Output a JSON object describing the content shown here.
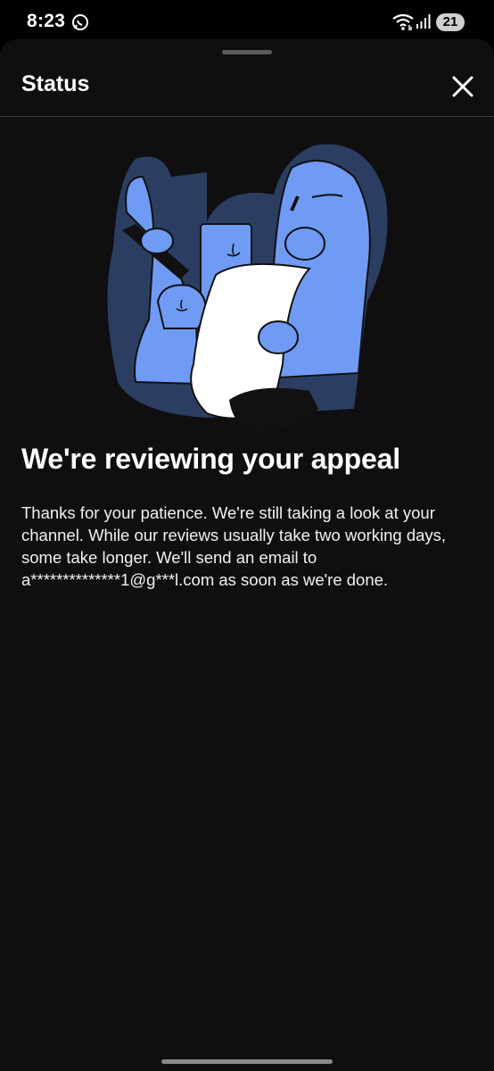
{
  "status_bar": {
    "time": "8:23",
    "battery": "21",
    "icons": [
      "whatsapp-icon",
      "wifi-icon",
      "signal-icon",
      "battery-icon"
    ]
  },
  "sheet": {
    "title": "Status",
    "close_icon": "close-icon",
    "illustration": "appeal-review-illustration",
    "headline": "We're reviewing your appeal",
    "body": "Thanks for your patience. We're still taking a look at your channel. While our reviews usually take two working days, some take longer. We'll send an email to a**************1@g***l.com as soon as we're done."
  },
  "colors": {
    "background": "#0f0f0f",
    "illustration_blue": "#6f9bf5",
    "illustration_dark_blue": "#2b3e62",
    "text": "#ffffff"
  }
}
